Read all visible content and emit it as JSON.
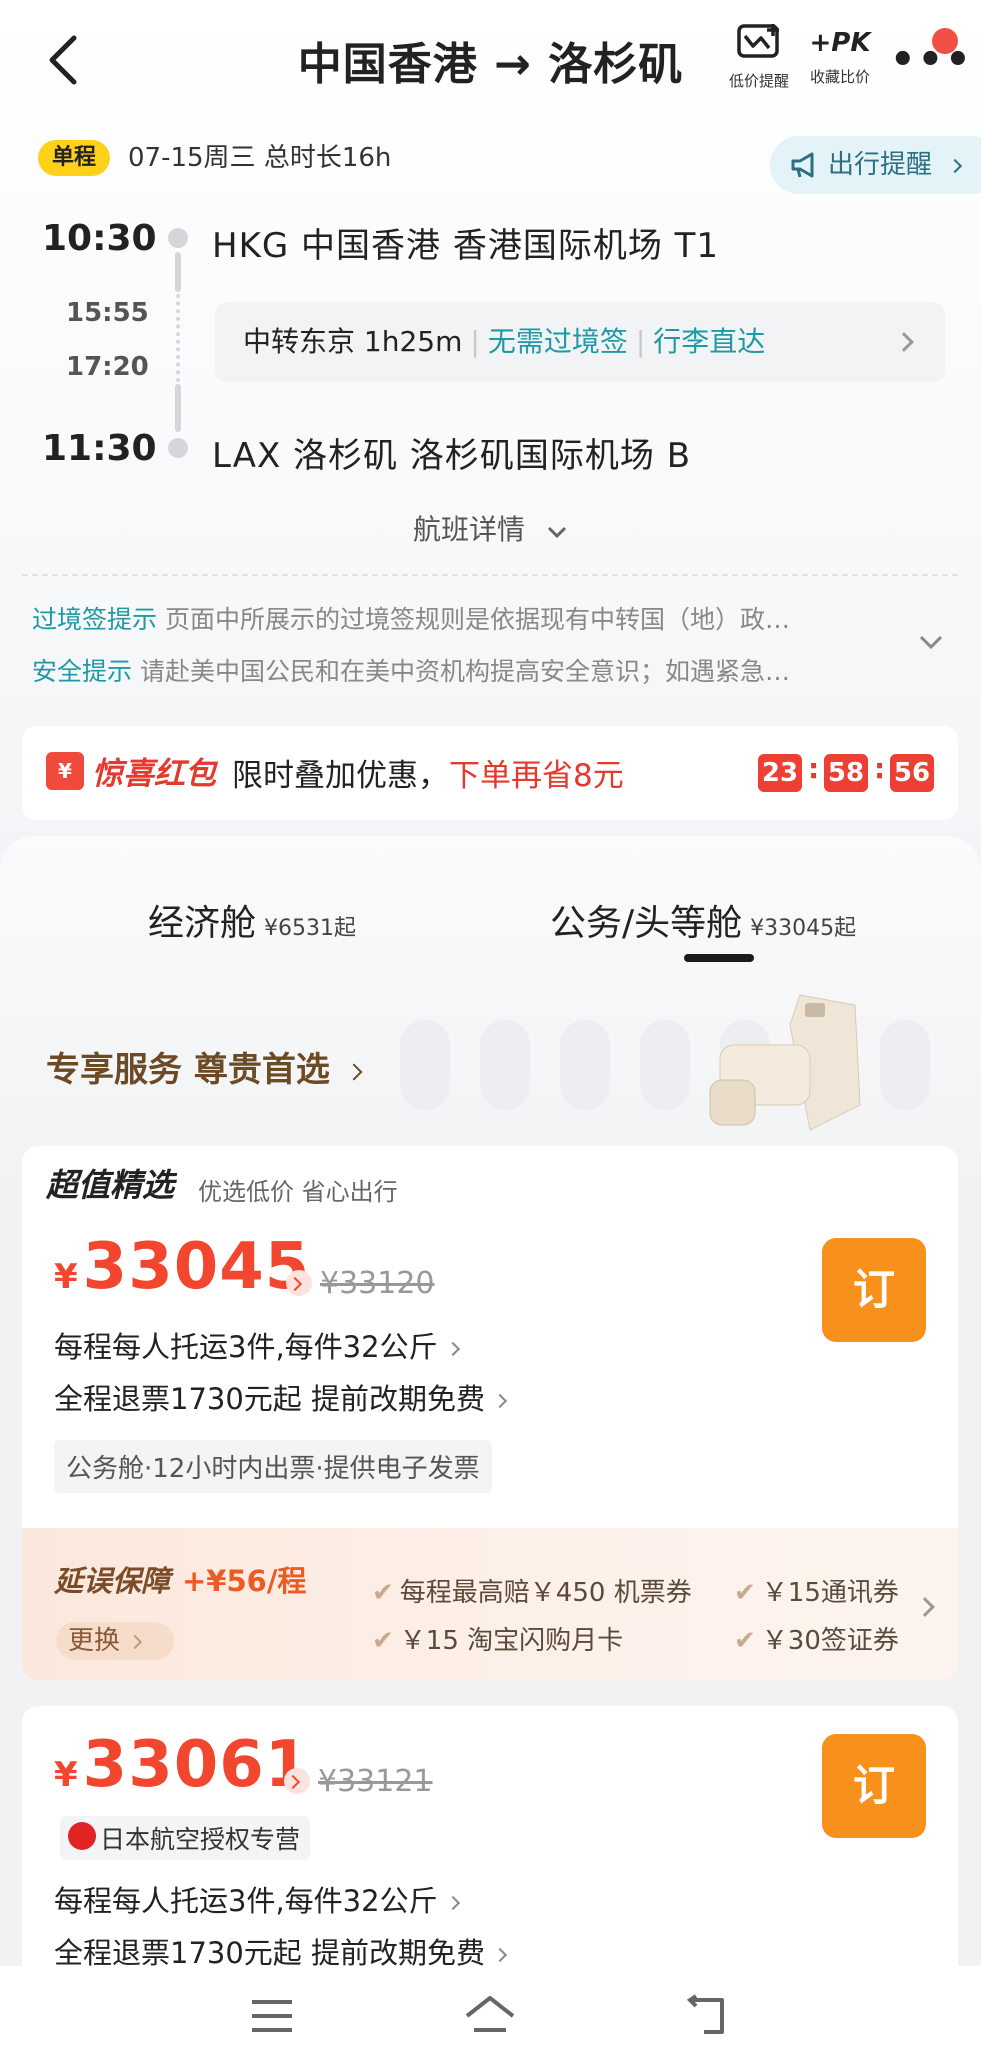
{
  "header": {
    "title": "中国香港 → 洛杉矶",
    "low_price_label": "低价提醒",
    "pk_label": "+PK",
    "compare_label": "收藏比价"
  },
  "trip": {
    "type_badge": "单程",
    "date_info": "07-15周三  总时长16h",
    "reminder_label": "出行提醒",
    "depart_time": "10:30",
    "depart_airport": "HKG  中国香港  香港国际机场  T1",
    "transfer_arrive": "15:55",
    "transfer_depart": "17:20",
    "transfer_text": "中转东京 1h25m",
    "no_visa": "无需过境签",
    "baggage_through": "行李直达",
    "arrive_time": "11:30",
    "arrive_airport": "LAX  洛杉矶  洛杉矶国际机场  B",
    "details_link": "航班详情"
  },
  "tips": [
    {
      "key": "过境签提示",
      "text": "页面中所展示的过境签规则是依据现有中转国（地）政…"
    },
    {
      "key": "安全提示",
      "text": "请赴美中国公民和在美中资机构提高安全意识；如遇紧急…"
    }
  ],
  "promo": {
    "icon": "¥",
    "name": "惊喜红包",
    "text": "限时叠加优惠，",
    "highlight": "下单再省8元",
    "countdown": [
      "23",
      "58",
      "56"
    ]
  },
  "cabins": [
    {
      "label": "经济舱",
      "price": "¥6531起"
    },
    {
      "label": "公务/头等舱",
      "price": "¥33045起"
    }
  ],
  "service_banner": "专享服务 尊贵首选",
  "offers": [
    {
      "badge": "超值精选",
      "badge_sub": "优选低价 省心出行",
      "currency": "¥",
      "price": "33045",
      "orig_price": "¥33120",
      "baggage": "每程每人托运3件,每件32公斤",
      "refund": "全程退票1730元起  提前改期免费",
      "tags": "公务舱·12小时内出票·提供电子发票",
      "book_label": "订"
    },
    {
      "currency": "¥",
      "price": "33061",
      "orig_price": "¥33121",
      "airline": "日本航空授权专营",
      "baggage": "每程每人托运3件,每件32公斤",
      "refund": "全程退票1730元起  提前改期免费",
      "book_label": "订"
    }
  ],
  "delay": {
    "title": "延误保障",
    "price": "+¥56/程",
    "swap": "更换",
    "items": [
      "每程最高赔￥450 机票券",
      "￥15通讯券",
      "￥15 淘宝闪购月卡",
      "￥30签证券"
    ]
  },
  "colors": {
    "accent_orange": "#f7911c",
    "price_red": "#f2462f",
    "teal": "#1d9aa6"
  }
}
